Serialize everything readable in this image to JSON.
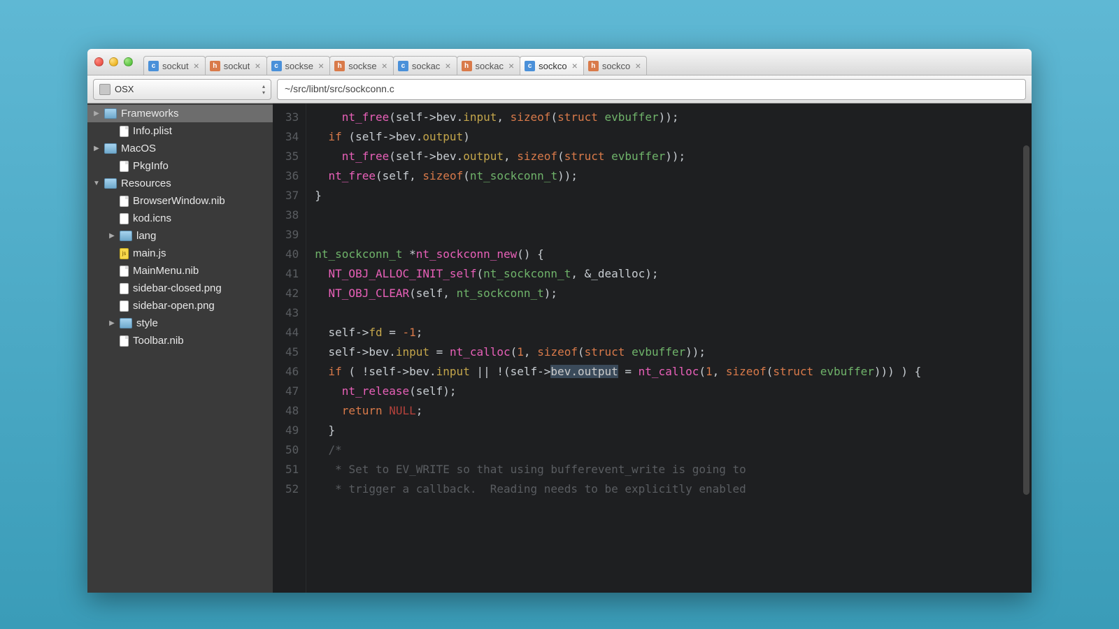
{
  "tabs": [
    {
      "icon": "c",
      "label": "sockut"
    },
    {
      "icon": "h",
      "label": "sockut"
    },
    {
      "icon": "c",
      "label": "sockse"
    },
    {
      "icon": "h",
      "label": "sockse"
    },
    {
      "icon": "c",
      "label": "sockac"
    },
    {
      "icon": "h",
      "label": "sockac"
    },
    {
      "icon": "c",
      "label": "sockco",
      "active": true
    },
    {
      "icon": "h",
      "label": "sockco"
    }
  ],
  "project_name": "OSX",
  "path": "~/src/libnt/src/sockconn.c",
  "sidebar": [
    {
      "type": "folder",
      "label": "Frameworks",
      "indent": 0,
      "arrow": "right",
      "selected": true
    },
    {
      "type": "file",
      "label": "Info.plist",
      "indent": 1
    },
    {
      "type": "folder",
      "label": "MacOS",
      "indent": 0,
      "arrow": "right"
    },
    {
      "type": "file",
      "label": "PkgInfo",
      "indent": 1
    },
    {
      "type": "folder",
      "label": "Resources",
      "indent": 0,
      "arrow": "down"
    },
    {
      "type": "file",
      "label": "BrowserWindow.nib",
      "indent": 1
    },
    {
      "type": "img",
      "label": "kod.icns",
      "indent": 1
    },
    {
      "type": "folder",
      "label": "lang",
      "indent": 1,
      "arrow": "right"
    },
    {
      "type": "js",
      "label": "main.js",
      "indent": 1
    },
    {
      "type": "file",
      "label": "MainMenu.nib",
      "indent": 1
    },
    {
      "type": "img",
      "label": "sidebar-closed.png",
      "indent": 1
    },
    {
      "type": "img",
      "label": "sidebar-open.png",
      "indent": 1
    },
    {
      "type": "folder",
      "label": "style",
      "indent": 1,
      "arrow": "right"
    },
    {
      "type": "file",
      "label": "Toolbar.nib",
      "indent": 1
    }
  ],
  "line_start": 33,
  "code_lines": [
    [
      {
        "t": "plain",
        "s": "    "
      },
      {
        "t": "fn",
        "s": "nt_free"
      },
      {
        "t": "plain",
        "s": "(self->bev."
      },
      {
        "t": "prop",
        "s": "input"
      },
      {
        "t": "plain",
        "s": ", "
      },
      {
        "t": "kw",
        "s": "sizeof"
      },
      {
        "t": "plain",
        "s": "("
      },
      {
        "t": "kw",
        "s": "struct"
      },
      {
        "t": "plain",
        "s": " "
      },
      {
        "t": "type",
        "s": "evbuffer"
      },
      {
        "t": "plain",
        "s": "));"
      }
    ],
    [
      {
        "t": "plain",
        "s": "  "
      },
      {
        "t": "kw",
        "s": "if"
      },
      {
        "t": "plain",
        "s": " (self->bev."
      },
      {
        "t": "prop",
        "s": "output"
      },
      {
        "t": "plain",
        "s": ")"
      }
    ],
    [
      {
        "t": "plain",
        "s": "    "
      },
      {
        "t": "fn",
        "s": "nt_free"
      },
      {
        "t": "plain",
        "s": "(self->bev."
      },
      {
        "t": "prop",
        "s": "output"
      },
      {
        "t": "plain",
        "s": ", "
      },
      {
        "t": "kw",
        "s": "sizeof"
      },
      {
        "t": "plain",
        "s": "("
      },
      {
        "t": "kw",
        "s": "struct"
      },
      {
        "t": "plain",
        "s": " "
      },
      {
        "t": "type",
        "s": "evbuffer"
      },
      {
        "t": "plain",
        "s": "));"
      }
    ],
    [
      {
        "t": "plain",
        "s": "  "
      },
      {
        "t": "fn",
        "s": "nt_free"
      },
      {
        "t": "plain",
        "s": "(self, "
      },
      {
        "t": "kw",
        "s": "sizeof"
      },
      {
        "t": "plain",
        "s": "("
      },
      {
        "t": "type",
        "s": "nt_sockconn_t"
      },
      {
        "t": "plain",
        "s": "));"
      }
    ],
    [
      {
        "t": "plain",
        "s": "}"
      }
    ],
    [],
    [],
    [
      {
        "t": "type",
        "s": "nt_sockconn_t"
      },
      {
        "t": "plain",
        "s": " *"
      },
      {
        "t": "fn",
        "s": "nt_sockconn_new"
      },
      {
        "t": "plain",
        "s": "() {"
      }
    ],
    [
      {
        "t": "plain",
        "s": "  "
      },
      {
        "t": "macro",
        "s": "NT_OBJ_ALLOC_INIT_self"
      },
      {
        "t": "plain",
        "s": "("
      },
      {
        "t": "type",
        "s": "nt_sockconn_t"
      },
      {
        "t": "plain",
        "s": ", &_dealloc);"
      }
    ],
    [
      {
        "t": "plain",
        "s": "  "
      },
      {
        "t": "macro",
        "s": "NT_OBJ_CLEAR"
      },
      {
        "t": "plain",
        "s": "(self, "
      },
      {
        "t": "type",
        "s": "nt_sockconn_t"
      },
      {
        "t": "plain",
        "s": ");"
      }
    ],
    [],
    [
      {
        "t": "plain",
        "s": "  self->"
      },
      {
        "t": "prop",
        "s": "fd"
      },
      {
        "t": "plain",
        "s": " = "
      },
      {
        "t": "num",
        "s": "-1"
      },
      {
        "t": "plain",
        "s": ";"
      }
    ],
    [
      {
        "t": "plain",
        "s": "  self->bev."
      },
      {
        "t": "prop",
        "s": "input"
      },
      {
        "t": "plain",
        "s": " = "
      },
      {
        "t": "fn",
        "s": "nt_calloc"
      },
      {
        "t": "plain",
        "s": "("
      },
      {
        "t": "num",
        "s": "1"
      },
      {
        "t": "plain",
        "s": ", "
      },
      {
        "t": "kw",
        "s": "sizeof"
      },
      {
        "t": "plain",
        "s": "("
      },
      {
        "t": "kw",
        "s": "struct"
      },
      {
        "t": "plain",
        "s": " "
      },
      {
        "t": "type",
        "s": "evbuffer"
      },
      {
        "t": "plain",
        "s": "));"
      }
    ],
    [
      {
        "t": "plain",
        "s": "  "
      },
      {
        "t": "kw",
        "s": "if"
      },
      {
        "t": "plain",
        "s": " ( !self->bev."
      },
      {
        "t": "prop",
        "s": "input"
      },
      {
        "t": "plain",
        "s": " || !(self->"
      },
      {
        "t": "sel",
        "s": "bev.output"
      },
      {
        "t": "plain",
        "s": " = "
      },
      {
        "t": "fn",
        "s": "nt_calloc"
      },
      {
        "t": "plain",
        "s": "("
      },
      {
        "t": "num",
        "s": "1"
      },
      {
        "t": "plain",
        "s": ", "
      },
      {
        "t": "kw",
        "s": "sizeof"
      },
      {
        "t": "plain",
        "s": "("
      },
      {
        "t": "kw",
        "s": "struct"
      },
      {
        "t": "plain",
        "s": " "
      },
      {
        "t": "type",
        "s": "evbuffer"
      },
      {
        "t": "plain",
        "s": "))) ) {"
      }
    ],
    [
      {
        "t": "plain",
        "s": "    "
      },
      {
        "t": "fn",
        "s": "nt_release"
      },
      {
        "t": "plain",
        "s": "(self);"
      }
    ],
    [
      {
        "t": "plain",
        "s": "    "
      },
      {
        "t": "kw",
        "s": "return"
      },
      {
        "t": "plain",
        "s": " "
      },
      {
        "t": "const",
        "s": "NULL"
      },
      {
        "t": "plain",
        "s": ";"
      }
    ],
    [
      {
        "t": "plain",
        "s": "  }"
      }
    ],
    [
      {
        "t": "plain",
        "s": "  "
      },
      {
        "t": "comment",
        "s": "/*"
      }
    ],
    [
      {
        "t": "plain",
        "s": "   "
      },
      {
        "t": "comment",
        "s": "* Set to EV_WRITE so that using bufferevent_write is going to"
      }
    ],
    [
      {
        "t": "plain",
        "s": "   "
      },
      {
        "t": "comment",
        "s": "* trigger a callback.  Reading needs to be explicitly enabled"
      }
    ]
  ]
}
